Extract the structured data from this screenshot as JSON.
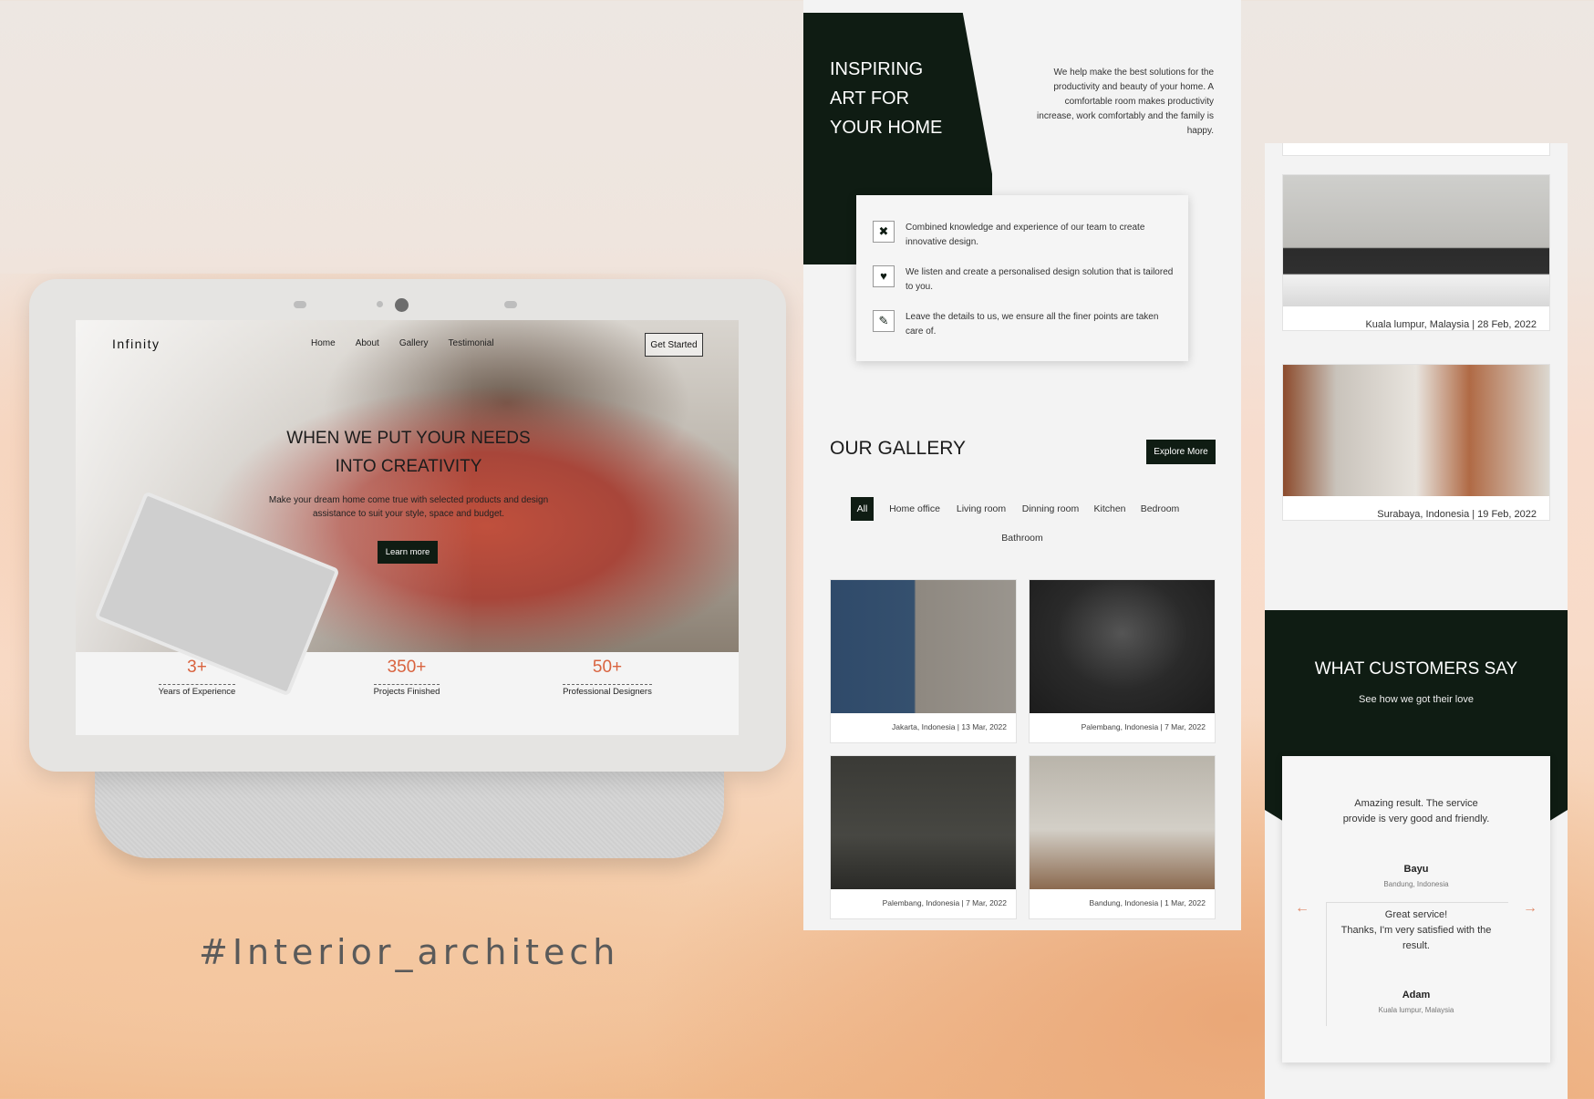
{
  "hashtag": "#Interior_architech",
  "site": {
    "logo": "Infinity",
    "nav": [
      "Home",
      "About",
      "Gallery",
      "Testimonial"
    ],
    "cta": "Get Started",
    "hero_title_1": "WHEN WE PUT YOUR NEEDS",
    "hero_title_2": "INTO CREATIVITY",
    "hero_sub": "Make your dream home come true with selected products and design assistance to suit your style, space and budget.",
    "learn_more": "Learn more",
    "stats": [
      {
        "num": "3+",
        "label": "Years of Experience"
      },
      {
        "num": "350+",
        "label": "Projects Finished"
      },
      {
        "num": "50+",
        "label": "Professional Designers"
      }
    ]
  },
  "middle": {
    "heading_1": "INSPIRING",
    "heading_2": "ART FOR",
    "heading_3": "YOUR HOME",
    "description": "We help make the best solutions for the productivity and beauty of your home. A comfortable room makes productivity increase, work comfortably and the family is happy.",
    "features": [
      {
        "icon": "tools-icon",
        "text": "Combined knowledge and experience of our team to create innovative design."
      },
      {
        "icon": "heart-icon",
        "text": "We listen and create a personalised design solution that is tailored to you."
      },
      {
        "icon": "magic-wand-icon",
        "text": "Leave the details to us, we ensure all the finer points are taken care of."
      }
    ],
    "gallery_title": "OUR GALLERY",
    "explore": "Explore More",
    "filters": [
      "All",
      "Home office",
      "Living room",
      "Dinning room",
      "Kitchen",
      "Bedroom",
      "Bathroom"
    ],
    "gallery": [
      {
        "caption": "Jakarta, Indonesia | 13 Mar, 2022"
      },
      {
        "caption": "Palembang, Indonesia | 7 Mar, 2022"
      },
      {
        "caption": "Palembang, Indonesia | 7 Mar, 2022"
      },
      {
        "caption": "Bandung, Indonesia | 1 Mar, 2022"
      }
    ]
  },
  "right": {
    "cards": [
      {
        "caption": "Kuala lumpur, Malaysia | 28 Feb, 2022"
      },
      {
        "caption": "Surabaya, Indonesia | 19 Feb, 2022"
      }
    ],
    "testimonial_title": "WHAT CUSTOMERS SAY",
    "testimonial_sub": "See how we got their love",
    "testimonials": [
      {
        "quote": "Amazing result. The service provide is very good and friendly.",
        "name": "Bayu",
        "location": "Bandung, Indonesia"
      },
      {
        "quote_1": "Great service!",
        "quote_2": "Thanks, I'm very satisfied with the result.",
        "name": "Adam",
        "location": "Kuala lumpur, Malaysia"
      }
    ]
  },
  "colors": {
    "dark_green": "#0f1c13",
    "accent_orange": "#d9633f"
  }
}
